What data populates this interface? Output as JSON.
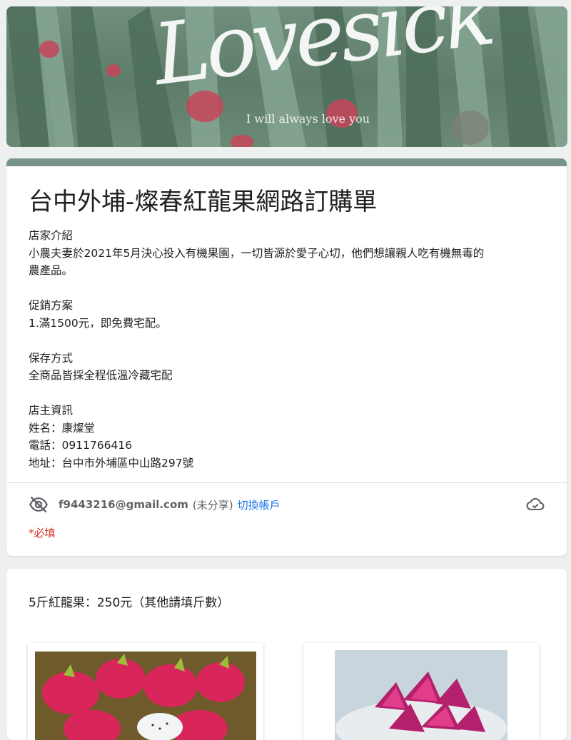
{
  "banner": {
    "script_title": "Lovesick",
    "script_subtitle": "I will always love you",
    "colors": {
      "cactus": "#5d7d6a",
      "fruit": "#c8455a"
    }
  },
  "form": {
    "title": "台中外埔-燦春紅龍果網路訂購單",
    "accent_color": "#78948a",
    "description": [
      "店家介紹",
      "小農夫妻於2021年5月決心投入有機果園，一切皆源於愛子心切，他們想讓親人吃有機無毒的",
      "農產品。",
      "",
      "促銷方案",
      "1.滿1500元，即免費宅配。",
      "",
      "保存方式",
      "全商品皆採全程低溫冷藏宅配",
      "",
      "店主資訊",
      "姓名：康燦堂",
      "電話：0911766416",
      "地址：台中市外埔區中山路297號"
    ],
    "account": {
      "email": "f9443216@gmail.com",
      "unshared": "(未分享)",
      "switch_label": "切換帳戶",
      "privacy_icon": "eye-off-icon",
      "save_icon": "cloud-check-icon"
    },
    "required_note": "*必填"
  },
  "question": {
    "title": "5斤紅龍果：250元（其他請填斤數）",
    "options": [
      {
        "image": "dragon-fruit-whole-photo"
      },
      {
        "image": "dragon-fruit-sliced-photo"
      }
    ]
  }
}
